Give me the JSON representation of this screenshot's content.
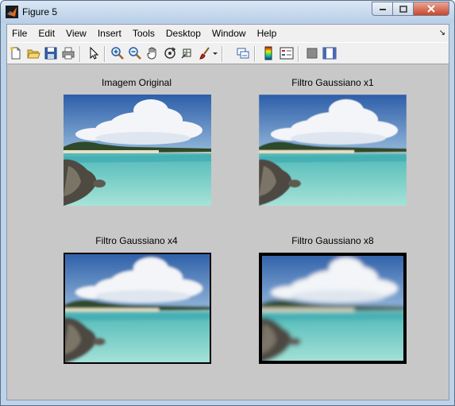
{
  "window": {
    "title": "Figure 5"
  },
  "menu": [
    "File",
    "Edit",
    "View",
    "Insert",
    "Tools",
    "Desktop",
    "Window",
    "Help"
  ],
  "toolbar": [
    "new-figure",
    "open-file",
    "save-figure",
    "print-figure",
    "edit-plot",
    "zoom-in",
    "zoom-out",
    "pan",
    "rotate-3d",
    "data-cursor",
    "brush",
    "link-plot",
    "insert-colorbar",
    "insert-legend",
    "hide-plot-tools",
    "show-plot-tools"
  ],
  "subplots": [
    {
      "title": "Imagem Original",
      "blur": 0,
      "frame": 0
    },
    {
      "title": "Filtro Gaussiano x1",
      "blur": 0.6,
      "frame": 0
    },
    {
      "title": "Filtro Gaussiano x4",
      "blur": 1.6,
      "frame": 2
    },
    {
      "title": "Filtro Gaussiano x8",
      "blur": 2.6,
      "frame": 4
    }
  ]
}
